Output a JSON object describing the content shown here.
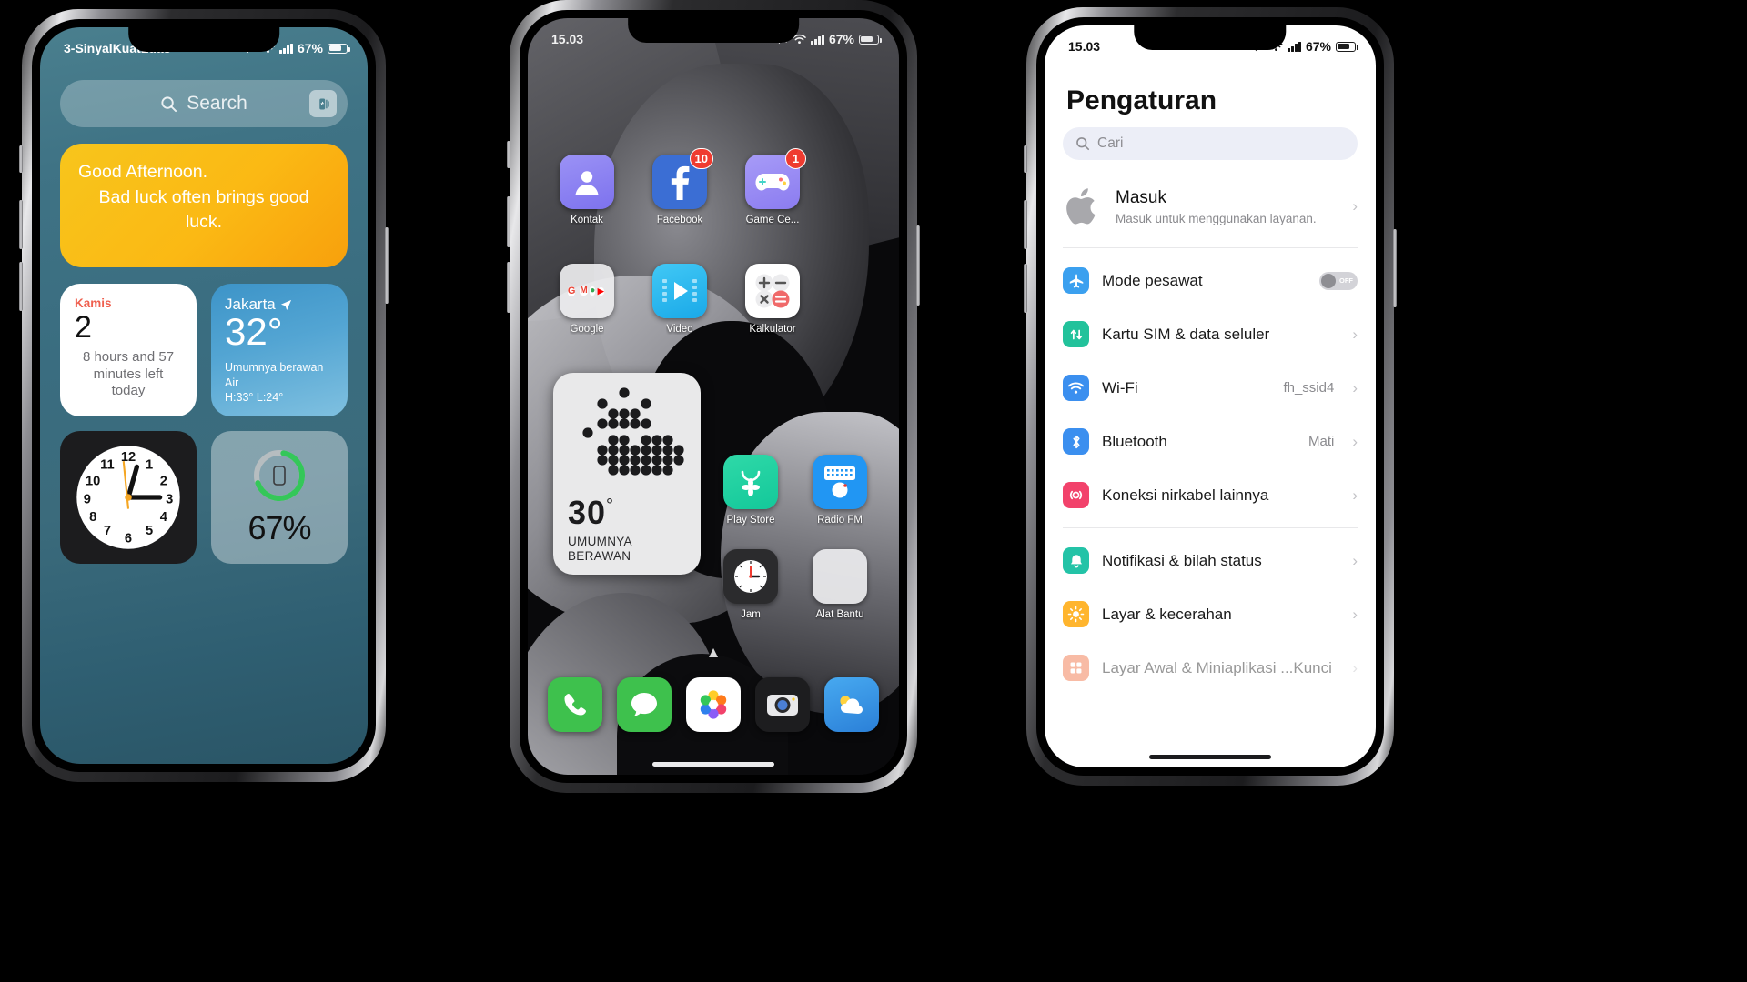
{
  "phone1": {
    "status": {
      "carrier": "3-SinyalKuatLuas",
      "battery_pct": "67%"
    },
    "search": {
      "placeholder": "Search"
    },
    "quote": {
      "line1": "Good Afternoon.",
      "line2": "Bad luck often brings good luck."
    },
    "calendar": {
      "day_of_week": "Kamis",
      "date": "2",
      "remaining": "8 hours and 57 minutes left today"
    },
    "weather": {
      "city": "Jakarta",
      "temp": "32°",
      "desc": "Umumnya berawan Air",
      "highlow": "H:33° L:24°"
    },
    "clock": {
      "numbers": [
        "12",
        "1",
        "2",
        "3",
        "4",
        "5",
        "6",
        "7",
        "8",
        "9",
        "10",
        "11"
      ]
    },
    "battery_widget": {
      "percent": "67%"
    }
  },
  "phone2": {
    "status": {
      "time": "15.03",
      "battery_pct": "67%"
    },
    "apps_row1": [
      {
        "label": "Kontak",
        "icon": "contacts-icon",
        "badge": ""
      },
      {
        "label": "Facebook",
        "icon": "facebook-icon",
        "badge": "10"
      },
      {
        "label": "Game Ce...",
        "icon": "game-center-icon",
        "badge": "1"
      }
    ],
    "apps_row2": [
      {
        "label": "Google",
        "icon": "google-folder-icon",
        "badge": ""
      },
      {
        "label": "Video",
        "icon": "video-icon",
        "badge": ""
      },
      {
        "label": "Kalkulator",
        "icon": "calculator-icon",
        "badge": ""
      }
    ],
    "apps_right": [
      {
        "label": "Play Store",
        "icon": "play-store-icon",
        "badge": ""
      },
      {
        "label": "Radio FM",
        "icon": "radio-fm-icon",
        "badge": ""
      },
      {
        "label": "Jam",
        "icon": "clock-icon",
        "badge": ""
      },
      {
        "label": "Alat Bantu",
        "icon": "tools-folder-icon",
        "badge": ""
      }
    ],
    "weather_widget": {
      "temp": "30",
      "degree": "°",
      "line1": "UMUMNYA",
      "line2": "BERAWAN"
    },
    "dock": [
      {
        "name": "phone-icon"
      },
      {
        "name": "messages-icon"
      },
      {
        "name": "photos-icon"
      },
      {
        "name": "camera-icon"
      },
      {
        "name": "weather-icon"
      }
    ]
  },
  "phone3": {
    "status": {
      "time": "15.03",
      "battery_pct": "67%"
    },
    "title": "Pengaturan",
    "search": {
      "placeholder": "Cari"
    },
    "account": {
      "name": "Masuk",
      "subtitle": "Masuk untuk menggunakan layanan."
    },
    "rows": [
      {
        "label": "Mode pesawat",
        "value": "",
        "icon": "airplane-icon",
        "color": "#3ba0ef",
        "control": "toggle",
        "toggle_label": "OFF"
      },
      {
        "label": "Kartu SIM & data seluler",
        "value": "",
        "icon": "sim-data-icon",
        "color": "#22c29b",
        "control": "chevron"
      },
      {
        "label": "Wi-Fi",
        "value": "fh_ssid4",
        "icon": "wifi-icon",
        "color": "#3b8fef",
        "control": "chevron"
      },
      {
        "label": "Bluetooth",
        "value": "Mati",
        "icon": "bluetooth-icon",
        "color": "#3b8fef",
        "control": "chevron"
      },
      {
        "label": "Koneksi nirkabel lainnya",
        "value": "",
        "icon": "wireless-icon",
        "color": "#f2426b",
        "control": "chevron"
      }
    ],
    "rows2": [
      {
        "label": "Notifikasi & bilah status",
        "value": "",
        "icon": "notifications-icon",
        "color": "#23c3a7",
        "control": "chevron"
      },
      {
        "label": "Layar & kecerahan",
        "value": "",
        "icon": "brightness-icon",
        "color": "#ffb52e",
        "control": "chevron"
      }
    ],
    "row_cut": {
      "label": "Layar Awal & Miniaplikasi ...Kunci",
      "icon": "homescreen-icon",
      "color": "#f06a3a"
    }
  }
}
